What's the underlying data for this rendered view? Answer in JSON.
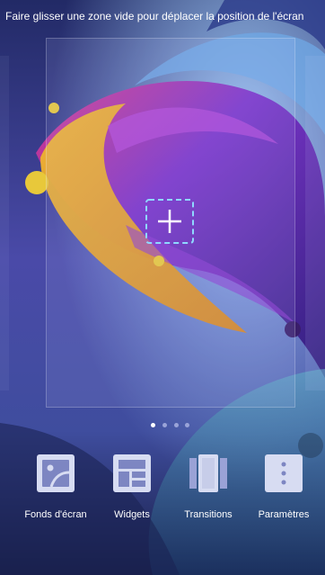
{
  "hint_text": "Faire glisser une zone vide pour déplacer la position de l'écran",
  "pages": {
    "count": 4,
    "active_index": 0,
    "active_color": "#ffffff",
    "inactive_color": "#9aa4d8"
  },
  "toolbar": {
    "items": [
      {
        "label": "Fonds d'écran",
        "icon": "wallpaper-icon"
      },
      {
        "label": "Widgets",
        "icon": "widgets-icon"
      },
      {
        "label": "Transitions",
        "icon": "transitions-icon"
      },
      {
        "label": "Paramètres",
        "icon": "settings-more-icon"
      }
    ]
  },
  "colors": {
    "accent": "#8fd8ff",
    "icon_fill": "#d7dcf2"
  }
}
